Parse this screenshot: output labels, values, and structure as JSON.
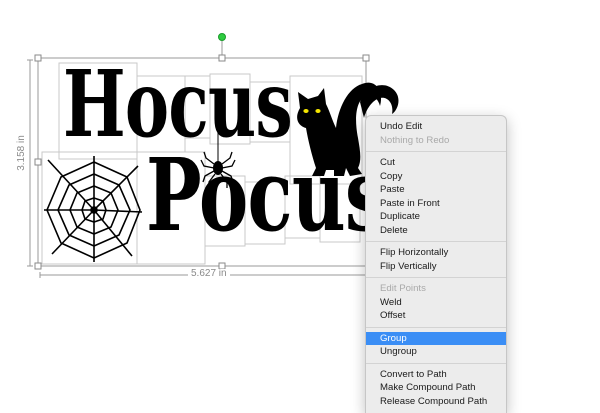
{
  "artwork": {
    "hocus_text": "Hocus",
    "pocus_text": "Pocus",
    "width_label": "5.627 in",
    "height_label": "3.158 in"
  },
  "menu": {
    "groups": [
      [
        {
          "label": "Undo Edit",
          "enabled": true
        },
        {
          "label": "Nothing to Redo",
          "enabled": false
        }
      ],
      [
        {
          "label": "Cut",
          "enabled": true
        },
        {
          "label": "Copy",
          "enabled": true
        },
        {
          "label": "Paste",
          "enabled": true
        },
        {
          "label": "Paste in Front",
          "enabled": true
        },
        {
          "label": "Duplicate",
          "enabled": true
        },
        {
          "label": "Delete",
          "enabled": true
        }
      ],
      [
        {
          "label": "Flip Horizontally",
          "enabled": true
        },
        {
          "label": "Flip Vertically",
          "enabled": true
        }
      ],
      [
        {
          "label": "Edit Points",
          "enabled": false
        },
        {
          "label": "Weld",
          "enabled": true
        },
        {
          "label": "Offset",
          "enabled": true
        }
      ],
      [
        {
          "label": "Group",
          "enabled": true,
          "selected": true
        },
        {
          "label": "Ungroup",
          "enabled": true
        }
      ],
      [
        {
          "label": "Convert to Path",
          "enabled": true
        },
        {
          "label": "Make Compound Path",
          "enabled": true
        },
        {
          "label": "Release Compound Path",
          "enabled": true
        }
      ]
    ]
  },
  "colors": {
    "selection_highlight": "#3b8ef5",
    "rotate_handle": "#2ecc40",
    "cat_eye": "#f5e600"
  }
}
